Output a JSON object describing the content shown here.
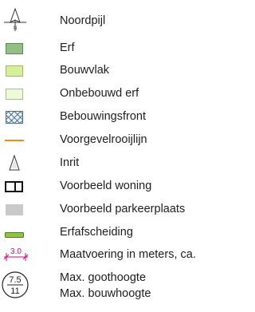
{
  "legend": {
    "items": [
      {
        "label": "Noordpijl",
        "icon": "north-arrow-icon",
        "glyph": "N"
      },
      {
        "label": "Erf",
        "icon": "yard-swatch",
        "fill": "#92bf83",
        "stroke": "#5d8a52"
      },
      {
        "label": "Bouwvlak",
        "icon": "building-area-swatch",
        "fill": "#d6ef9b",
        "stroke": "#9fb86a"
      },
      {
        "label": "Onbebouwd erf",
        "icon": "unbuilt-yard-swatch",
        "fill": "#eef9d9",
        "stroke": "#a8bc8c"
      },
      {
        "label": "Bebouwingsfront",
        "icon": "building-front-hatch-icon",
        "stroke": "#4a6d8c"
      },
      {
        "label": "Voorgevelrooijlijn",
        "icon": "facade-line-icon",
        "color": "#f28a1a"
      },
      {
        "label": "Inrit",
        "icon": "driveway-triangle-icon",
        "stroke": "#333333"
      },
      {
        "label": "Voorbeeld woning",
        "icon": "house-example-icon",
        "stroke": "#111111"
      },
      {
        "label": "Voorbeeld parkeerplaats",
        "icon": "parking-example-swatch",
        "fill": "#c9c9cb"
      },
      {
        "label": "Erfafscheiding",
        "icon": "fence-swatch",
        "fill": "#8ec63f",
        "stroke": "#4e7d1e"
      },
      {
        "label": "Maatvoering in meters, ca.",
        "icon": "dimension-icon",
        "glyph": "3.0",
        "color": "#e2007a"
      },
      {
        "label": "Max. goothoogte",
        "label2": "Max. bouwhoogte",
        "icon": "height-circle-icon",
        "glyph_top": "7.5",
        "glyph_bottom": "11"
      }
    ]
  }
}
